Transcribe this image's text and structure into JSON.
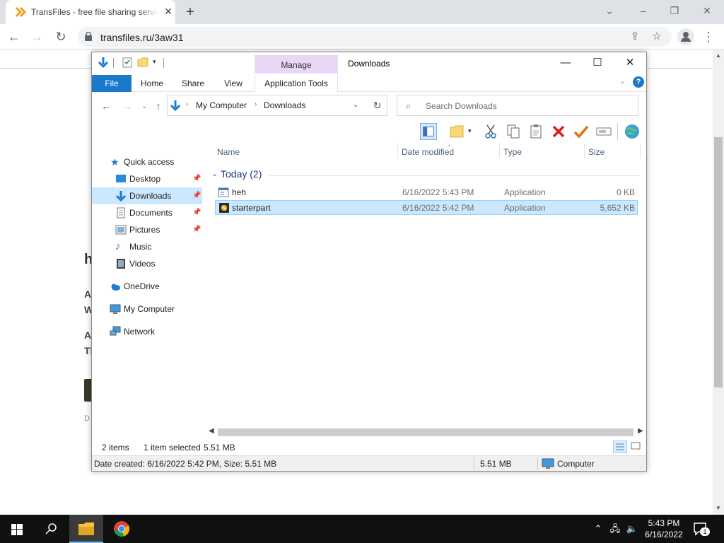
{
  "browser": {
    "tab_title": "TransFiles - free file sharing service",
    "url": "transfiles.ru/3aw31"
  },
  "webpage": {
    "heading": "h",
    "line1": "A",
    "line2": "W",
    "line3": "A",
    "line4": "Tl",
    "small": "D"
  },
  "explorer": {
    "title": "Downloads",
    "manage_label": "Manage",
    "ribbon_tabs": [
      "File",
      "Home",
      "Share",
      "View",
      "Application Tools"
    ],
    "breadcrumb": [
      "My Computer",
      "Downloads"
    ],
    "search_placeholder": "Search Downloads",
    "nav": {
      "quick_access": "Quick access",
      "desktop": "Desktop",
      "downloads": "Downloads",
      "documents": "Documents",
      "pictures": "Pictures",
      "music": "Music",
      "videos": "Videos",
      "onedrive": "OneDrive",
      "my_computer": "My Computer",
      "network": "Network"
    },
    "columns": [
      "Name",
      "Date modified",
      "Type",
      "Size"
    ],
    "group_label": "Today (2)",
    "files": [
      {
        "name": "heh",
        "date": "6/16/2022 5:43 PM",
        "type": "Application",
        "size": "0 KB"
      },
      {
        "name": "starterpart",
        "date": "6/16/2022 5:42 PM",
        "type": "Application",
        "size": "5,652 KB"
      }
    ],
    "status": {
      "items": "2 items",
      "selected": "1 item selected",
      "sel_size": "5.51 MB",
      "details": "Date created: 6/16/2022 5:42 PM, Size: 5.51 MB",
      "size2": "5.51 MB",
      "location": "Computer"
    }
  },
  "taskbar": {
    "time": "5:43 PM",
    "date": "6/16/2022",
    "notification_count": "1"
  },
  "colors": {
    "file_tab": "#1979ca",
    "selection": "#cce8ff",
    "manage_tab": "#e9d7f8"
  }
}
